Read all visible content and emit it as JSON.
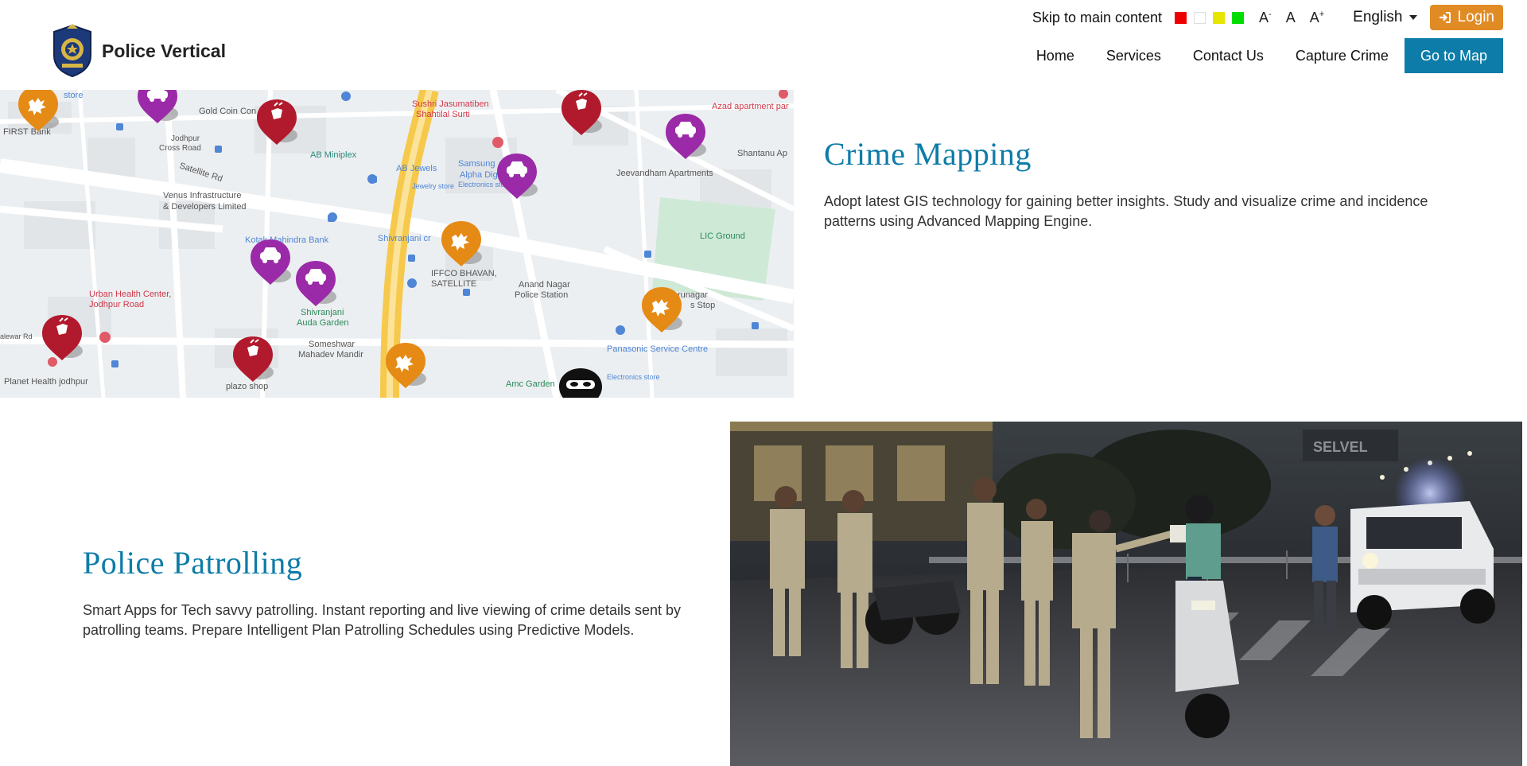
{
  "header": {
    "skip_link": "Skip to main content",
    "contrast_swatches": [
      {
        "name": "red-theme-swatch",
        "color": "#ee0000"
      },
      {
        "name": "white-theme-swatch",
        "color": "#ffffff"
      },
      {
        "name": "yellow-theme-swatch",
        "color": "#e6e600"
      },
      {
        "name": "green-theme-swatch",
        "color": "#00dd00"
      }
    ],
    "font_decrease": "A",
    "font_decrease_sup": "-",
    "font_normal": "A",
    "font_increase": "A",
    "font_increase_sup": "+",
    "language": "English",
    "login_label": "Login",
    "brand_title": "Police Vertical",
    "accent_color": "#0d7ca8",
    "login_color": "#e18b25"
  },
  "nav": {
    "items": [
      "Home",
      "Services",
      "Contact Us",
      "Capture Crime"
    ],
    "cta": "Go to Map"
  },
  "map": {
    "labels": {
      "gold_coin": "Gold Coin Con",
      "store": "store",
      "first_bank": "FIRST Bank",
      "jodhpur_cross": "Jodhpur",
      "jodhpur_cross2": "Cross Road",
      "satellite_rd": "Satellite Rd",
      "ab_miniplex": "AB Miniplex",
      "ab_jewels": "AB Jewels",
      "jewelry_store": "Jewelry store",
      "venus": "Venus Infrastructure",
      "venus2": "& Developers Limited",
      "sushri": "Sushri Jasumatiben",
      "sushri2": "Shahtilal Surti",
      "samsung": "Samsung",
      "alpha_digital": "Alpha Digital",
      "electronics_store": "Electronics store",
      "azad": "Azad apartment par",
      "shantanu": "Shantanu Ap",
      "jeevandham": "Jeevandham Apartments",
      "kotak": "Kotak Mahindra Bank",
      "shivranjani_cross": "Shivranjani cr",
      "lic_ground": "LIC Ground",
      "iffco": "IFFCO BHAVAN,",
      "iffco2": "SATELLITE",
      "anand_nagar": "Anand Nagar",
      "anand_nagar2": "Police Station",
      "urban_health": "Urban Health Center,",
      "urban_health2": "Jodhpur Road",
      "shivranjani": "Shivranjani",
      "auda": "Auda Garden",
      "runagar": "runagar",
      "s_stop": "s Stop",
      "panasonic": "Panasonic Service Centre",
      "electronics_store2": "Electronics store",
      "someshwar": "Someshwar",
      "mahadev": "Mahadev Mandir",
      "plazo": "plazo shop",
      "amc_garden": "Amc Garden",
      "planet_health": "Planet Health jodhpur",
      "alewar_rd": "alewar Rd"
    },
    "marker_types": [
      "protest-marker",
      "vehicle-theft-marker",
      "accident-marker",
      "burglar-marker"
    ]
  },
  "crime_mapping": {
    "title": "Crime Mapping",
    "text": "Adopt latest GIS technology for gaining better insights. Study and visualize crime and incidence patterns using Advanced Mapping Engine."
  },
  "patrolling": {
    "title": "Police Patrolling",
    "text": "Smart Apps for Tech savvy patrolling. Instant reporting and live viewing of crime details sent by patrolling teams. Prepare Intelligent Plan Patrolling Schedules using Predictive Models.",
    "photo_sign": "SELVEL"
  }
}
